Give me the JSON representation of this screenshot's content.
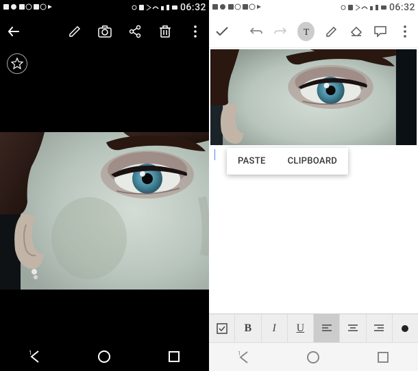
{
  "status_bar": {
    "time": "06:32",
    "right_time": "06:32"
  },
  "left_toolbar": {
    "back": "←",
    "edit": "✎",
    "camera": "📷",
    "share": "⋔",
    "delete": "🗑",
    "more": "⋮"
  },
  "star": "☆",
  "context_menu": {
    "paste": "PASTE",
    "clipboard": "CLIPBOARD"
  },
  "format_toolbar": {
    "checkbox": "☑",
    "bold": "B",
    "italic": "I",
    "underline": "U",
    "align_left": "≡",
    "align_center": "≡",
    "align_right": "≡",
    "bullet": "●"
  },
  "nav": {
    "back": "◁",
    "home": "○",
    "recent": "□"
  }
}
